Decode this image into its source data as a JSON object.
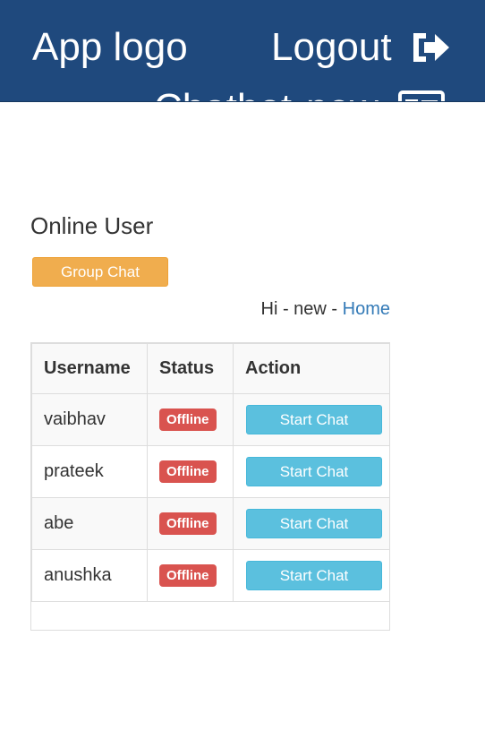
{
  "navbar": {
    "brand": "App logo",
    "logout_label": "Logout",
    "logout_icon": "sign-out-icon",
    "chat_label": "Chatbot",
    "user_label": "new",
    "user_icon": "id-card-icon",
    "background": "#1f497d"
  },
  "main": {
    "heading": "Online User",
    "group_chat_label": "Group Chat",
    "greeting_prefix": "Hi - new - ",
    "home_link": "Home"
  },
  "table": {
    "columns": [
      "Username",
      "Status",
      "Action"
    ],
    "rows": [
      {
        "username": "vaibhav",
        "status": "Offline",
        "action": "Start Chat"
      },
      {
        "username": "prateek",
        "status": "Offline",
        "action": "Start Chat"
      },
      {
        "username": "abe",
        "status": "Offline",
        "action": "Start Chat"
      },
      {
        "username": "anushka",
        "status": "Offline",
        "action": "Start Chat"
      }
    ]
  },
  "colors": {
    "warning": "#f0ad4e",
    "danger": "#d9534f",
    "info": "#5bc0de",
    "link": "#337ab7"
  }
}
